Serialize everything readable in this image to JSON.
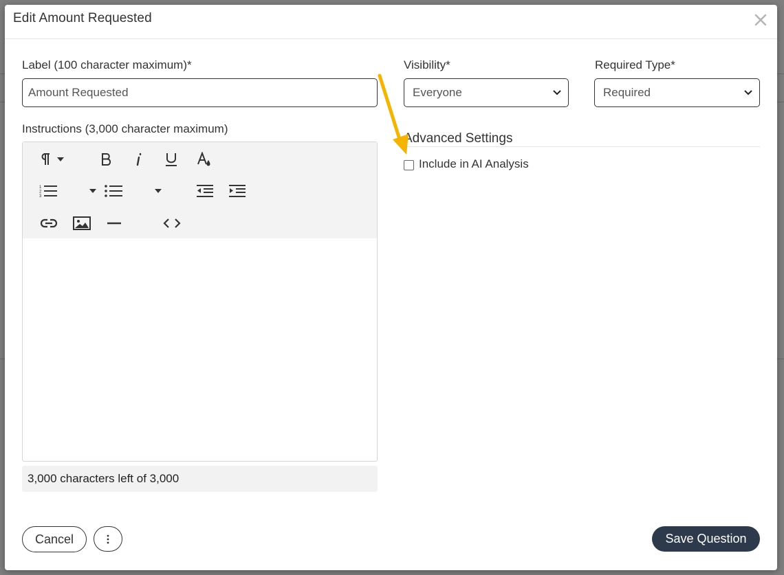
{
  "dialog": {
    "title": "Edit Amount Requested",
    "close_icon": "close-icon"
  },
  "form": {
    "label_field": {
      "label": "Label (100 character maximum)*",
      "value": "Amount Requested"
    },
    "visibility": {
      "label": "Visibility*",
      "selected": "Everyone"
    },
    "required_type": {
      "label": "Required Type*",
      "selected": "Required"
    },
    "instructions": {
      "label": "Instructions (3,000 character maximum)",
      "toolbar_icons": [
        "paragraph-icon",
        "bold-icon",
        "italic-icon",
        "underline-icon",
        "font-color-icon",
        "ordered-list-icon",
        "unordered-list-icon",
        "outdent-icon",
        "indent-icon",
        "link-icon",
        "image-icon",
        "horizontal-rule-icon",
        "code-view-icon"
      ],
      "char_count": "3,000 characters left of 3,000"
    },
    "advanced": {
      "title": "Advanced Settings",
      "ai_checkbox_label": "Include in AI Analysis",
      "ai_checked": false
    }
  },
  "footer": {
    "cancel_label": "Cancel",
    "more_icon": "more-vertical-icon",
    "save_label": "Save Question"
  },
  "colors": {
    "annotation_arrow": "#f5b400",
    "primary_button": "#2c3a4b"
  }
}
